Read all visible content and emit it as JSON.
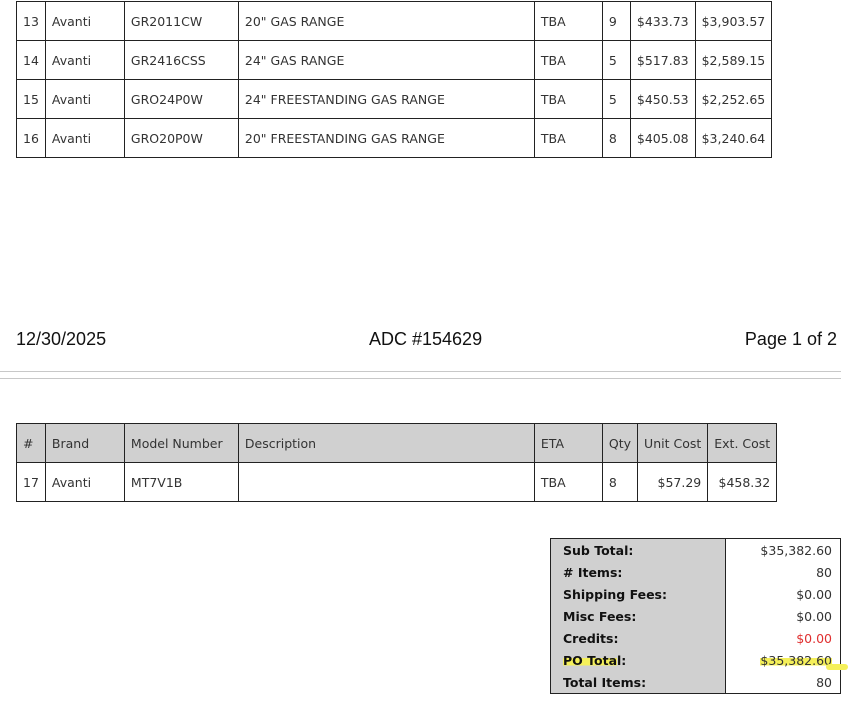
{
  "top_rows": [
    {
      "num": "13",
      "brand": "Avanti",
      "model": "GR2011CW",
      "desc": "20\" GAS RANGE",
      "eta": "TBA",
      "qty": "9",
      "unit": "$433.73",
      "ext": "$3,903.57"
    },
    {
      "num": "14",
      "brand": "Avanti",
      "model": "GR2416CSS",
      "desc": "24\" GAS RANGE",
      "eta": "TBA",
      "qty": "5",
      "unit": "$517.83",
      "ext": "$2,589.15"
    },
    {
      "num": "15",
      "brand": "Avanti",
      "model": "GRO24P0W",
      "desc": "24\" FREESTANDING GAS RANGE",
      "eta": "TBA",
      "qty": "5",
      "unit": "$450.53",
      "ext": "$2,252.65"
    },
    {
      "num": "16",
      "brand": "Avanti",
      "model": "GRO20P0W",
      "desc": "20\" FREESTANDING GAS RANGE",
      "eta": "TBA",
      "qty": "8",
      "unit": "$405.08",
      "ext": "$3,240.64"
    }
  ],
  "page_header": {
    "date": "12/30/2025",
    "doc": "ADC #154629",
    "page": "Page 1 of 2"
  },
  "columns": {
    "num": "#",
    "brand": "Brand",
    "model": "Model Number",
    "desc": "Description",
    "eta": "ETA",
    "qty": "Qty",
    "unit": "Unit Cost",
    "ext": "Ext. Cost"
  },
  "bottom_rows": [
    {
      "num": "17",
      "brand": "Avanti",
      "model": "MT7V1B",
      "desc": "",
      "eta": "TBA",
      "qty": "8",
      "unit": "$57.29",
      "ext": "$458.32"
    }
  ],
  "summary": {
    "subtotal_label": "Sub Total:",
    "subtotal": "$35,382.60",
    "items_label": "# Items:",
    "items": "80",
    "shipping_label": "Shipping Fees:",
    "shipping": "$0.00",
    "misc_label": "Misc Fees:",
    "misc": "$0.00",
    "credits_label": "Credits:",
    "credits": "$0.00",
    "po_total_label_a": "PO Tota",
    "po_total_label_b": "l:",
    "po_total": "$35,382.60",
    "total_items_label": "Total Items:",
    "total_items": "80"
  },
  "colors": {
    "header_bg": "#d0d0d0",
    "credit_red": "#e03030",
    "highlight": "#f5f05a"
  }
}
